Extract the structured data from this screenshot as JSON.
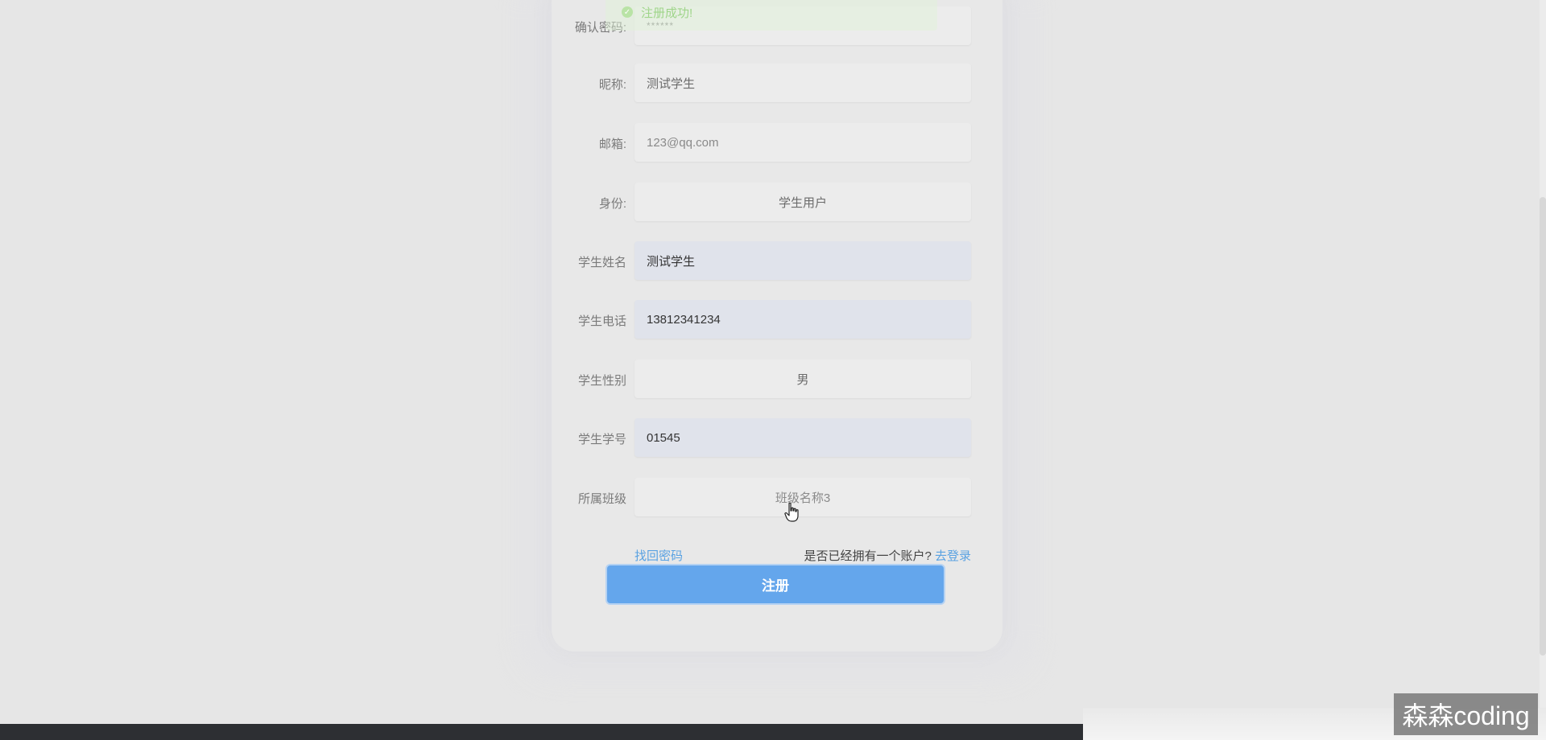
{
  "toast": {
    "message": "注册成功!",
    "icon": "check-circle-icon",
    "color": "#9fd58a"
  },
  "form": {
    "fields": [
      {
        "label": "确认密码:",
        "value": "******"
      },
      {
        "label": "昵称:",
        "value": "测试学生"
      },
      {
        "label": "邮箱:",
        "value": "123@qq.com"
      },
      {
        "label": "身份:",
        "value": "学生用户"
      },
      {
        "label": "学生姓名",
        "value": "测试学生"
      },
      {
        "label": "学生电话",
        "value": "13812341234"
      },
      {
        "label": "学生性别",
        "value": "男"
      },
      {
        "label": "学生学号",
        "value": "01545"
      },
      {
        "label": "所属班级",
        "value": "班级名称3"
      }
    ],
    "forgot_password": "找回密码",
    "have_account_text": "是否已经拥有一个账户?",
    "go_login": "去登录",
    "register_button": "注册"
  },
  "watermark": "森森coding",
  "colors": {
    "primary_button": "#64a6ec",
    "link": "#5aa2e2",
    "autofill_bg": "#e0e3eb"
  }
}
